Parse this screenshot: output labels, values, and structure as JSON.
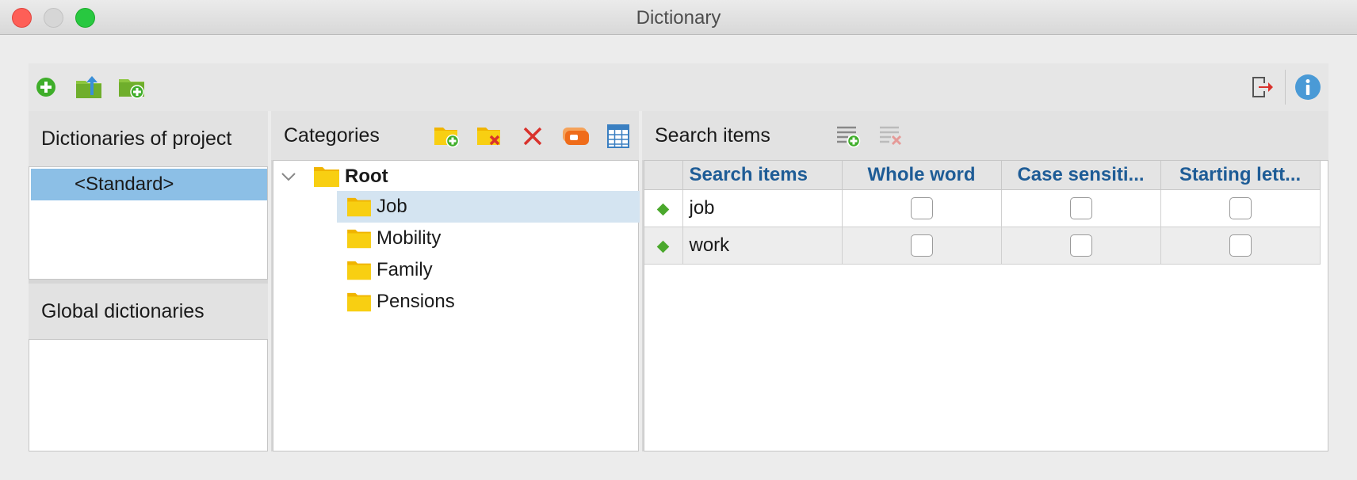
{
  "window": {
    "title": "Dictionary"
  },
  "toolbar": {
    "buttons": [
      {
        "icon": "add-circle-icon"
      },
      {
        "icon": "folder-export-icon"
      },
      {
        "icon": "folder-add-icon"
      },
      {
        "icon": "exit-icon"
      },
      {
        "icon": "info-icon"
      }
    ]
  },
  "dictionaries": {
    "project_heading": "Dictionaries of project",
    "project_items": [
      "<Standard>"
    ],
    "global_heading": "Global dictionaries"
  },
  "categories": {
    "heading": "Categories",
    "root": "Root",
    "children": [
      "Job",
      "Mobility",
      "Family",
      "Pensions"
    ]
  },
  "search": {
    "heading": "Search items",
    "columns": [
      "Search items",
      "Whole word",
      "Case sensiti...",
      "Starting lett..."
    ],
    "rows": [
      {
        "term": "job",
        "whole_word": false,
        "case_sensitive": false,
        "starting_letters": false
      },
      {
        "term": "work",
        "whole_word": false,
        "case_sensitive": false,
        "starting_letters": false
      }
    ]
  },
  "colors": {
    "accent_blue": "#1e5c96",
    "selection": "#8cbfe6",
    "folder_yellow": "#f8cf12",
    "green": "#4aa82c",
    "red": "#d9322c"
  }
}
